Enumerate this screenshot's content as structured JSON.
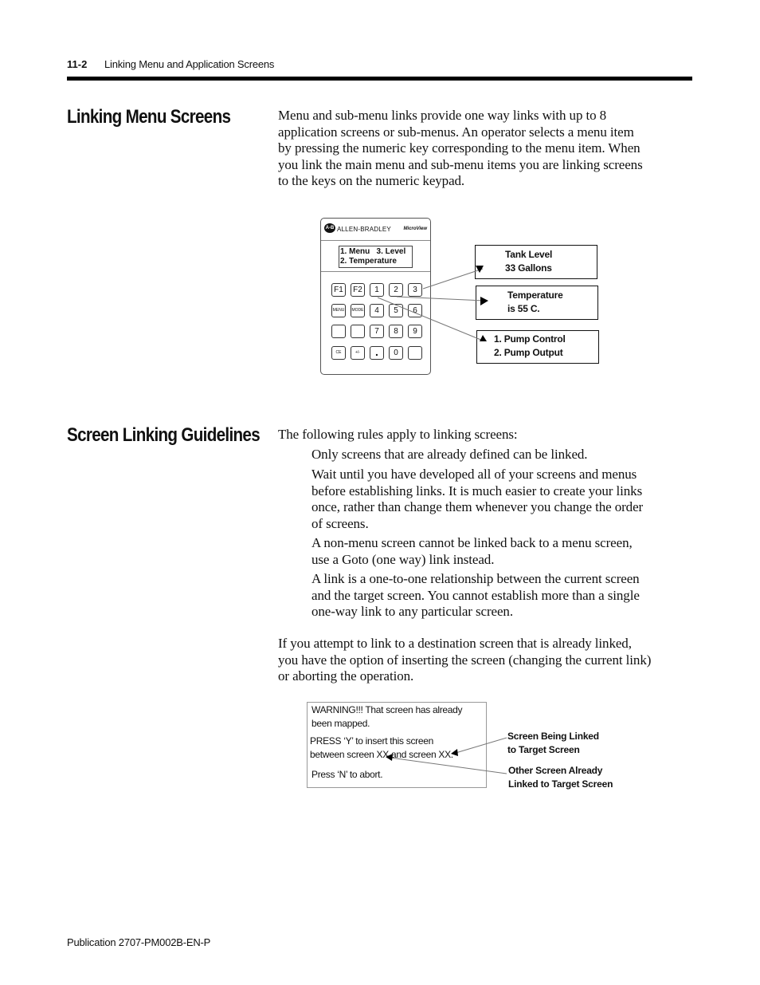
{
  "header": {
    "page_number": "11-2",
    "chapter_title": "Linking Menu and Application Screens"
  },
  "sections": {
    "linking_menu": {
      "heading": "Linking Menu Screens",
      "paragraph_lines": [
        "Menu and sub-menu links provide one way links with up to 8",
        "application screens or sub-menus.  An operator selects a menu item",
        "by pressing the numeric key corresponding to the menu item.  When",
        "you link the main menu and sub-menu items you are linking screens",
        "to the keys on the numeric keypad."
      ]
    },
    "guidelines": {
      "heading": "Screen Linking Guidelines",
      "intro": "The following rules apply to linking screens:",
      "rules": [
        [
          "Only screens that are already defined can be linked."
        ],
        [
          "Wait until you have developed all of your screens and menus",
          "before establishing links.  It is much easier to create your links",
          "once, rather than change them whenever you change the order",
          "of screens."
        ],
        [
          "A non-menu screen cannot be linked back to a menu screen,",
          "use a Goto (one way) link instead."
        ],
        [
          "A link is a one-to-one relationship between the current screen",
          "and the target screen.  You cannot establish more than a single",
          "one-way link to any particular screen."
        ]
      ],
      "closing_lines": [
        "If you attempt to link to a destination screen that is already linked,",
        "you have the option of inserting the screen (changing the current link)",
        "or aborting the operation."
      ]
    }
  },
  "device_figure": {
    "brand": "ALLEN-BRADLEY",
    "logo_text": "A-B",
    "product": "MicroView",
    "display_lines": [
      "1. Menu   3. Level",
      "2. Temperature"
    ],
    "keys": [
      [
        "F1",
        "F2",
        "1",
        "2",
        "3"
      ],
      [
        "MENU",
        "MODE",
        "4",
        "5",
        "6"
      ],
      [
        "",
        "",
        "7",
        "8",
        "9"
      ],
      [
        "CE",
        "+/-",
        ".",
        "0",
        ""
      ]
    ],
    "callouts": {
      "tank": [
        "Tank Level",
        "33 Gallons"
      ],
      "temperature": [
        "Temperature",
        "is 55 C."
      ],
      "pump": [
        "1. Pump Control",
        "2. Pump Output"
      ]
    }
  },
  "warning_figure": {
    "lines": [
      "WARNING!!!   That screen has already",
      "been mapped.",
      "PRESS ‘Y’ to insert this screen",
      "between screen XX and screen XX.",
      "Press ‘N’ to abort."
    ],
    "labels": {
      "being_linked": [
        "Screen Being Linked",
        "to Target Screen"
      ],
      "already_linked": [
        "Other Screen Already",
        "Linked to Target Screen"
      ]
    }
  },
  "footer": {
    "publication": "Publication 2707-PM002B-EN-P"
  }
}
